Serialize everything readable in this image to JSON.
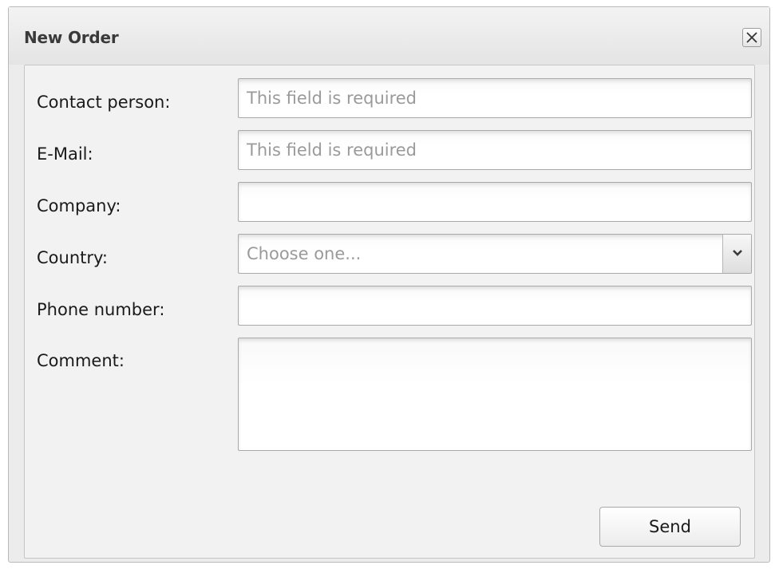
{
  "dialog": {
    "title": "New Order",
    "close_icon": "close-icon"
  },
  "form": {
    "contact_person": {
      "label": "Contact person:",
      "placeholder": "This field is required",
      "value": ""
    },
    "email": {
      "label": "E-Mail:",
      "placeholder": "This field is required",
      "value": ""
    },
    "company": {
      "label": "Company:",
      "placeholder": "",
      "value": ""
    },
    "country": {
      "label": "Country:",
      "selected": "Choose one...",
      "arrow_icon": "chevron-down-icon"
    },
    "phone": {
      "label": "Phone number:",
      "placeholder": "",
      "value": ""
    },
    "comment": {
      "label": "Comment:",
      "placeholder": "",
      "value": ""
    }
  },
  "actions": {
    "send_label": "Send"
  }
}
